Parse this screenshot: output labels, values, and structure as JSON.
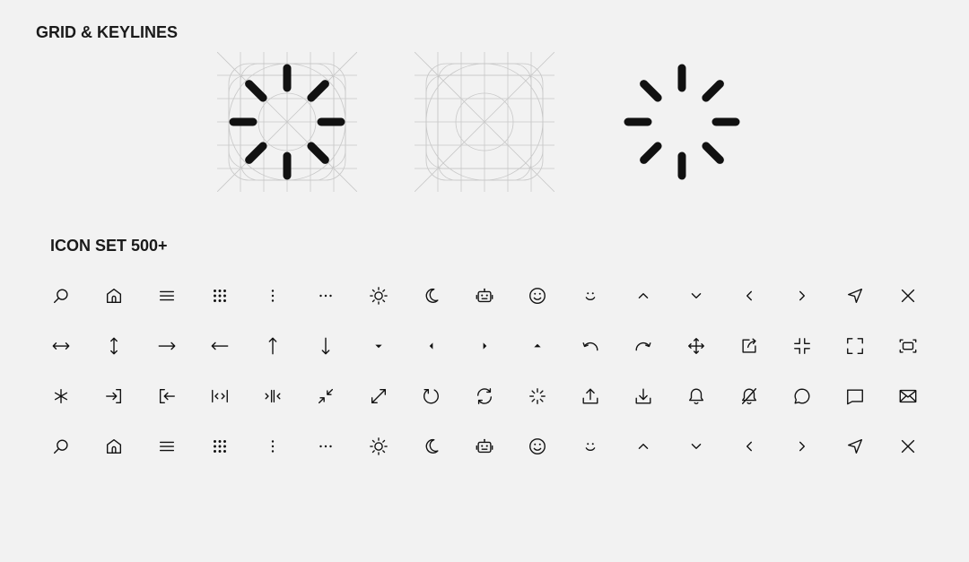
{
  "sections": {
    "grid_title": "GRID & KEYLINES",
    "icons_title": "ICON SET 500+"
  },
  "heroes": [
    {
      "name": "loader-with-grid",
      "icon": "spinner-icon",
      "grid": true
    },
    {
      "name": "keyline-grid",
      "icon": "",
      "grid": true
    },
    {
      "name": "loader-final",
      "icon": "spinner-icon",
      "grid": false
    }
  ],
  "icon_rows": [
    [
      "search",
      "home",
      "menu",
      "grid",
      "more-vertical",
      "more-horizontal",
      "sun",
      "moon",
      "robot",
      "smile",
      "smile-small",
      "chevron-up",
      "chevron-down",
      "chevron-left",
      "chevron-right",
      "navigation",
      "close"
    ],
    [
      "arrows-horizontal",
      "arrows-vertical",
      "arrow-right",
      "arrow-left",
      "arrow-up",
      "arrow-down",
      "caret-down",
      "caret-left",
      "caret-right",
      "caret-up",
      "undo",
      "redo",
      "move",
      "share",
      "minimize",
      "maximize",
      "screen-capture"
    ],
    [
      "asterisk",
      "log-in",
      "log-out",
      "code-horizontal",
      "compress-horizontal",
      "shrink",
      "expand",
      "rotate",
      "refresh",
      "loader",
      "upload",
      "download",
      "bell",
      "bell-off",
      "message-circle",
      "message-square",
      "mail"
    ],
    [
      "search",
      "home",
      "menu",
      "grid",
      "more-vertical",
      "more-horizontal",
      "sun",
      "moon",
      "robot",
      "smile",
      "smile-small",
      "chevron-up",
      "chevron-down",
      "chevron-left",
      "chevron-right",
      "navigation",
      "close"
    ]
  ],
  "colors": {
    "background": "#f2f2f2",
    "ink": "#111111",
    "grid": "#c8c8c8"
  }
}
